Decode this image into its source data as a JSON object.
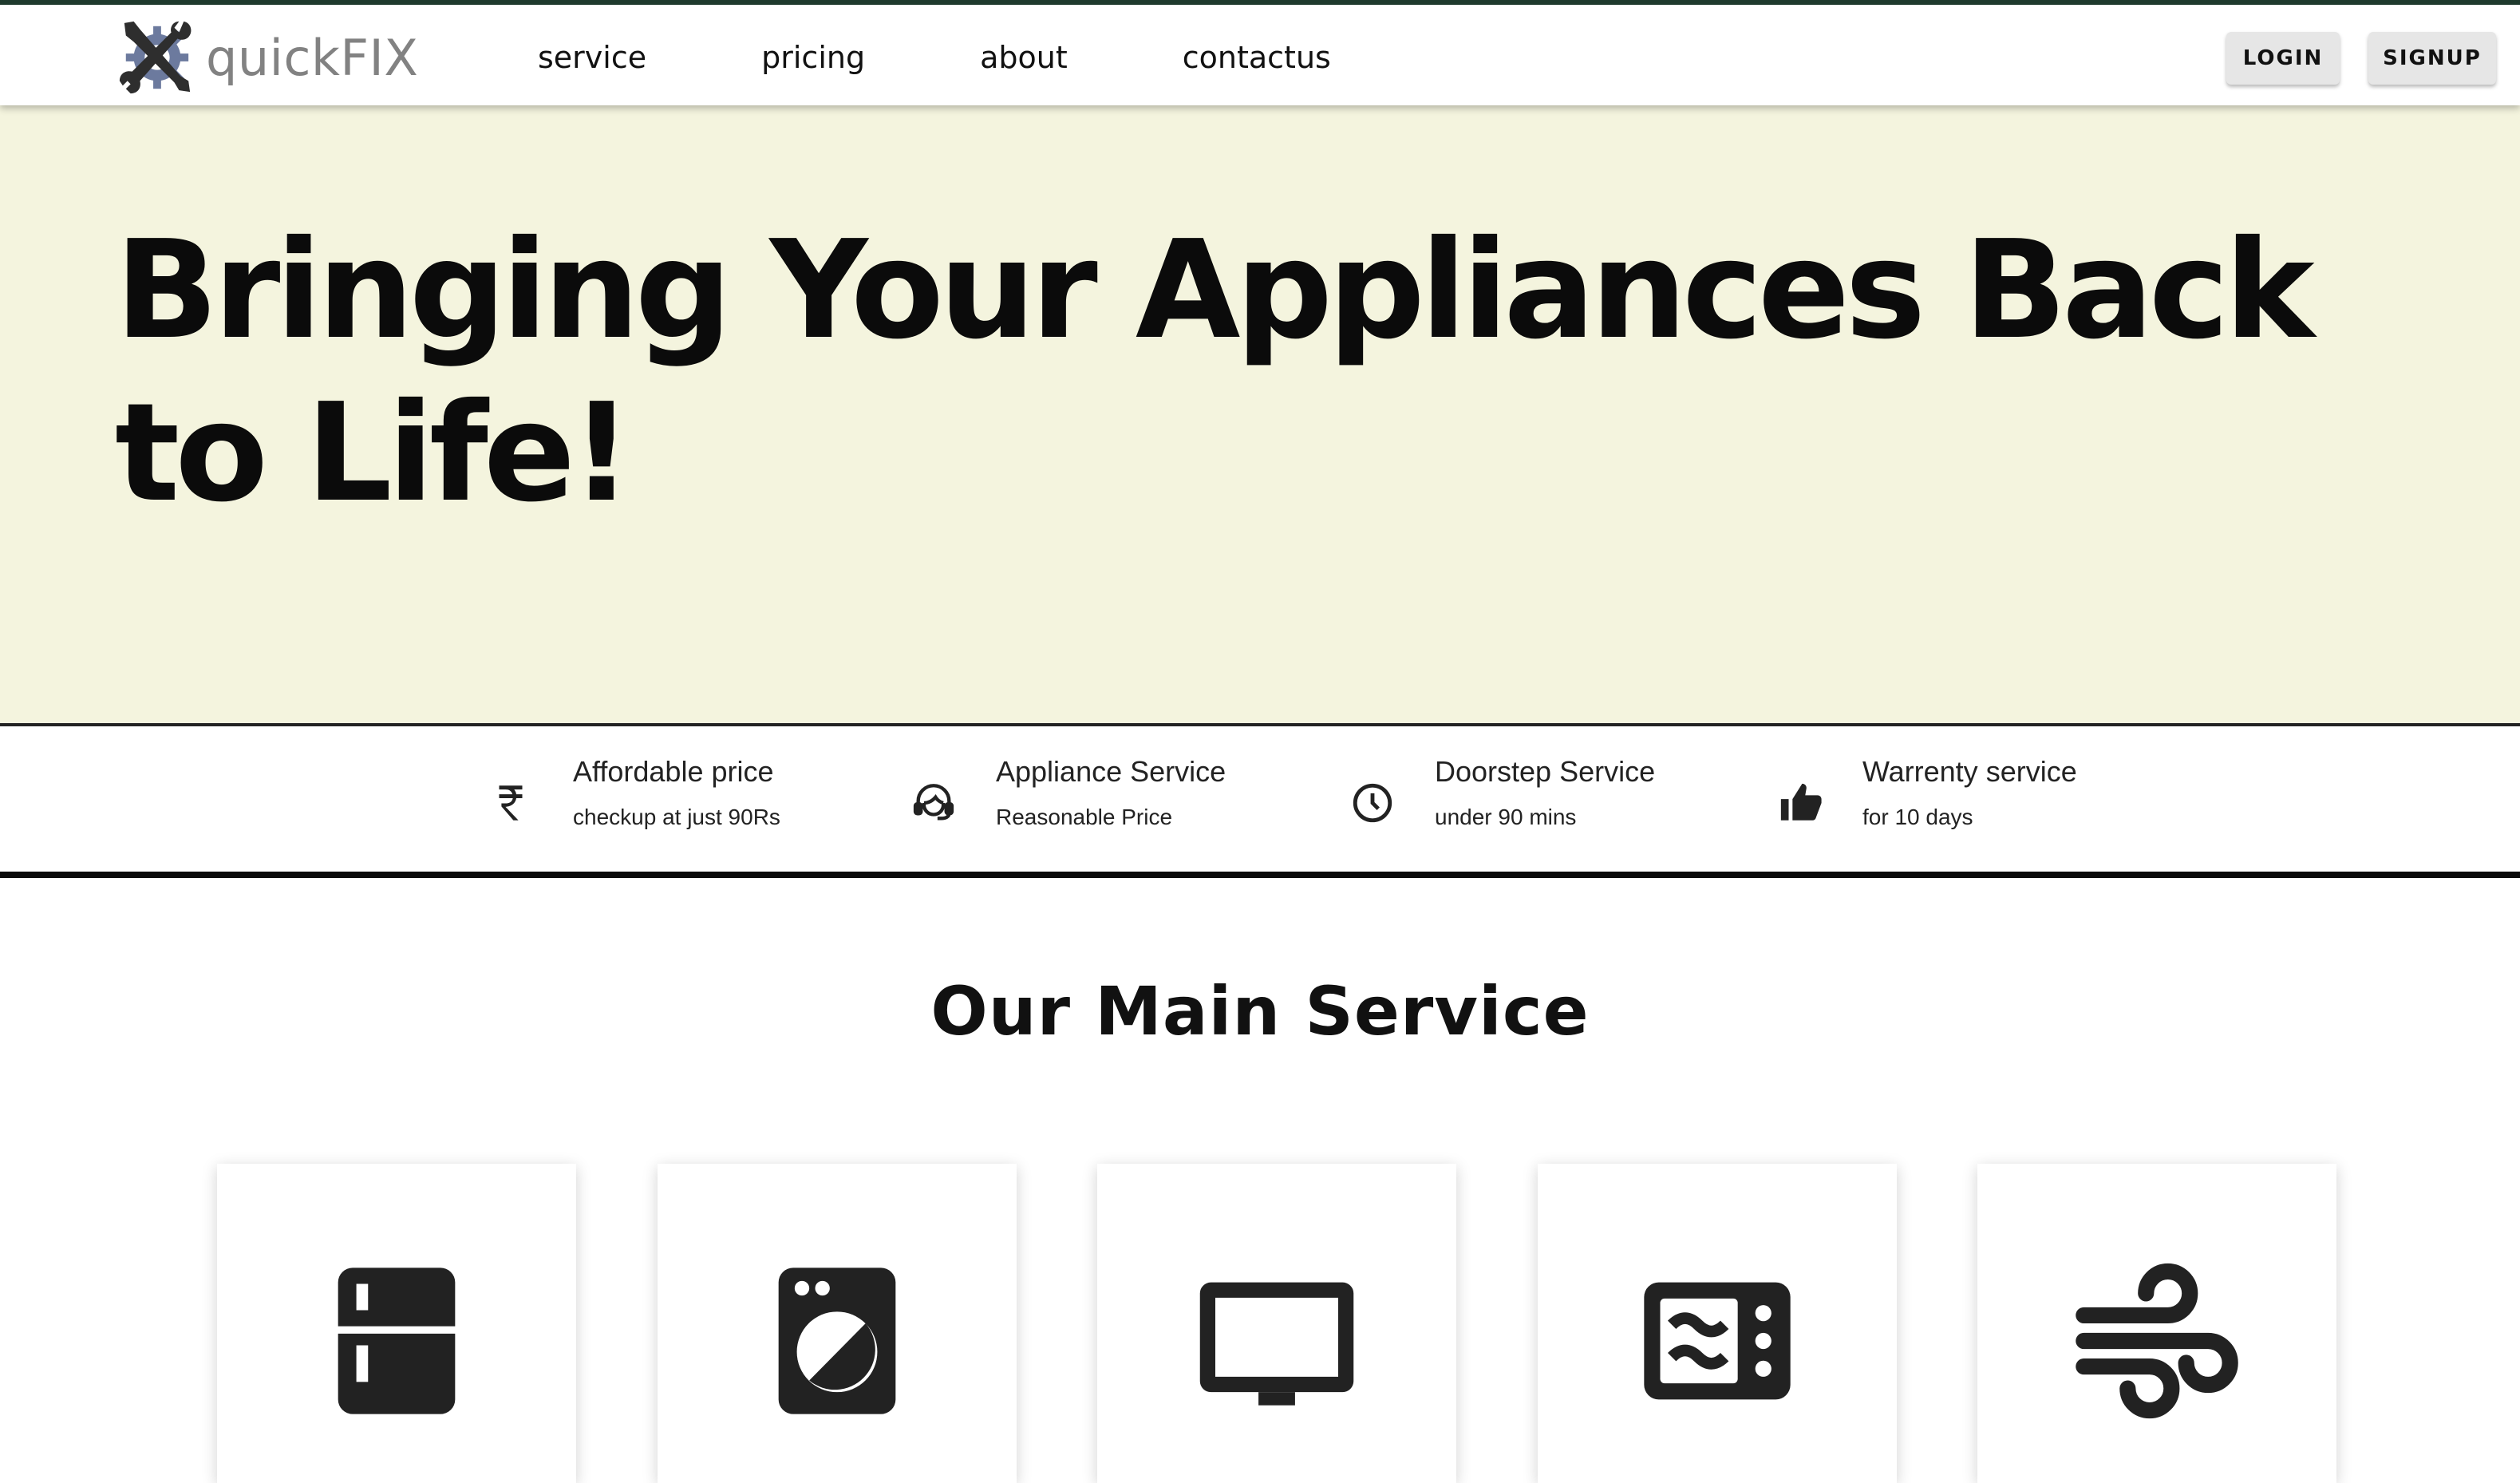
{
  "brand": {
    "name": "quickFIX",
    "icon": "wrench-gear-icon",
    "icon_color": "#6c7a9e"
  },
  "nav": {
    "links": [
      {
        "label": "service"
      },
      {
        "label": "pricing"
      },
      {
        "label": "about"
      },
      {
        "label": "contactus"
      }
    ],
    "login_label": "LOGIN",
    "signup_label": "SIGNUP"
  },
  "hero": {
    "title": "Bringing Your Appliances Back to Life!",
    "background": "#f4f4de"
  },
  "features": [
    {
      "icon": "rupee-icon",
      "title": "Affordable price",
      "subtitle": "checkup at just 90Rs"
    },
    {
      "icon": "headset-agent-icon",
      "title": "Appliance Service",
      "subtitle": "Reasonable Price"
    },
    {
      "icon": "clock-icon",
      "title": "Doorstep Service",
      "subtitle": "under 90 mins"
    },
    {
      "icon": "thumbs-up-icon",
      "title": "Warrenty service",
      "subtitle": "for 10 days"
    }
  ],
  "main_service": {
    "title": "Our Main Service",
    "cards": [
      {
        "icon": "refrigerator-icon"
      },
      {
        "icon": "washing-machine-icon"
      },
      {
        "icon": "television-icon"
      },
      {
        "icon": "microwave-icon"
      },
      {
        "icon": "air-conditioner-icon"
      }
    ]
  }
}
